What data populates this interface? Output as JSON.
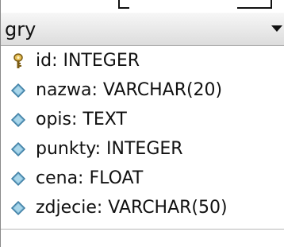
{
  "entity": {
    "name": "gry",
    "fields": [
      {
        "label": "id: INTEGER",
        "key": true
      },
      {
        "label": "nazwa: VARCHAR(20)",
        "key": false
      },
      {
        "label": "opis: TEXT",
        "key": false
      },
      {
        "label": "punkty: INTEGER",
        "key": false
      },
      {
        "label": "cena: FLOAT",
        "key": false
      },
      {
        "label": "zdjecie: VARCHAR(50)",
        "key": false
      }
    ]
  },
  "icons": {
    "collapse": "chevron-down-icon",
    "primary_key": "key-icon",
    "attribute": "field-diamond-icon"
  },
  "colors": {
    "header_top": "#f7f7f7",
    "header_bottom": "#dcdcdc",
    "key_gold": "#d4a63a",
    "diamond_blue": "#68a7c8",
    "text": "#111111"
  }
}
